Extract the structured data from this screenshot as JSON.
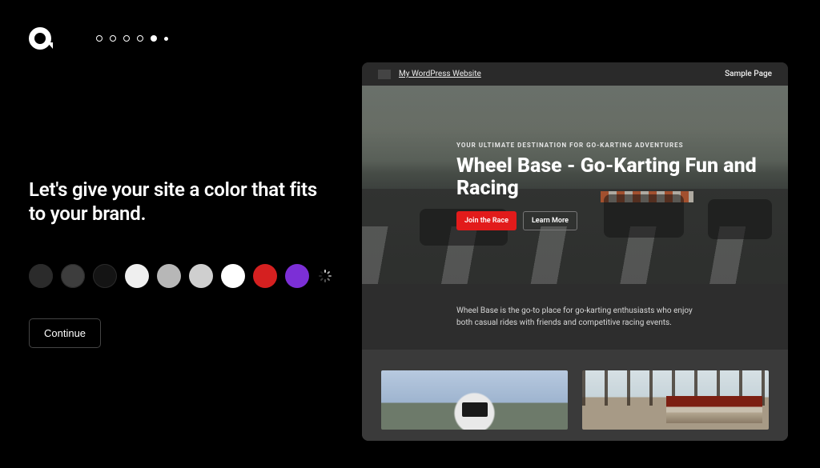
{
  "progress": {
    "total": 6,
    "current_index": 4
  },
  "heading": "Let's give your site a color that fits to your brand.",
  "colors": [
    {
      "name": "charcoal",
      "hex": "#2b2b2b"
    },
    {
      "name": "dim-gray",
      "hex": "#3d3d3d"
    },
    {
      "name": "near-black",
      "hex": "#141414"
    },
    {
      "name": "off-white",
      "hex": "#efefef"
    },
    {
      "name": "silver",
      "hex": "#b7b7b7"
    },
    {
      "name": "light-gray",
      "hex": "#cfcfcf"
    },
    {
      "name": "white",
      "hex": "#ffffff"
    },
    {
      "name": "red",
      "hex": "#d52020"
    },
    {
      "name": "purple",
      "hex": "#7c2fd6"
    }
  ],
  "continue_label": "Continue",
  "preview": {
    "site_name": "My WordPress Website",
    "nav_link": "Sample Page",
    "hero": {
      "tagline": "YOUR ULTIMATE DESTINATION FOR GO-KARTING ADVENTURES",
      "title": "Wheel Base - Go-Karting Fun and Racing",
      "primary_button": "Join the Race",
      "secondary_button": "Learn More"
    },
    "description": "Wheel Base is the go-to place for go-karting enthusiasts who enjoy both casual rides with friends and competitive racing events."
  }
}
